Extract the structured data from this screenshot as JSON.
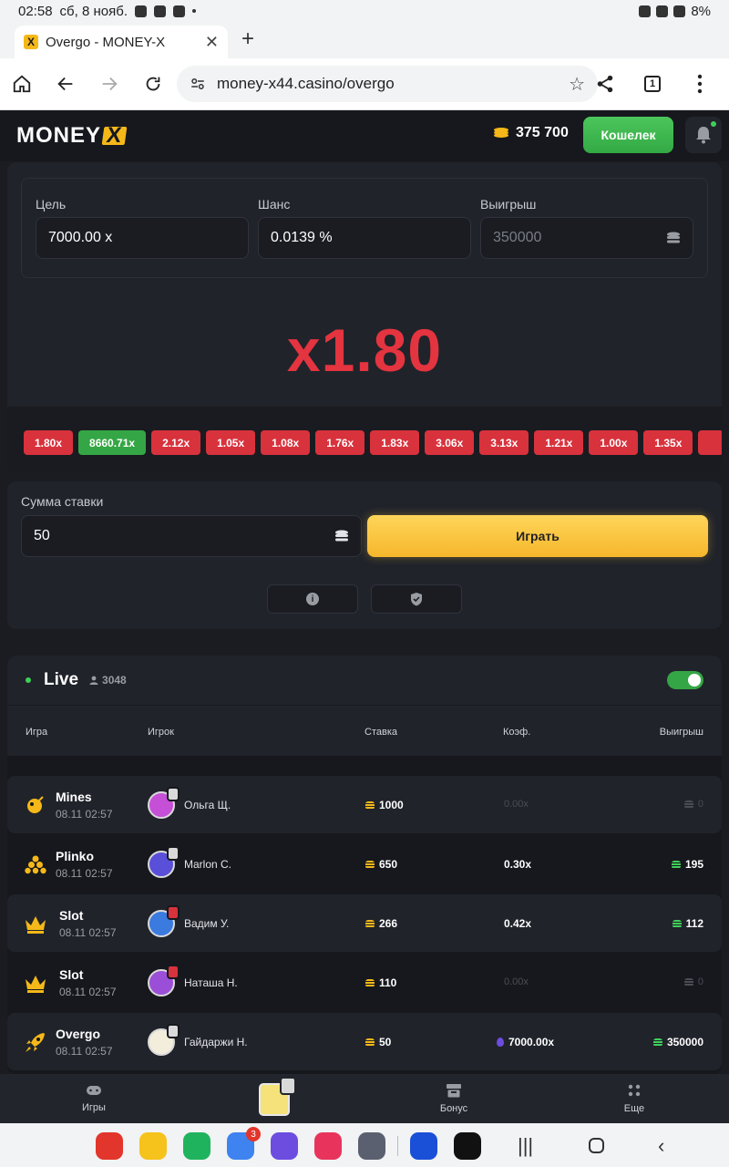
{
  "statusbar": {
    "time": "02:58",
    "date": "сб, 8 нояб.",
    "battery": "8%"
  },
  "browser": {
    "tab_title": "Overgo - MONEY-X",
    "favicon_letter": "X",
    "url": "money-x44.casino/overgo",
    "tab_count": "1"
  },
  "header": {
    "logo_text": "MONEY",
    "logo_x": "X",
    "balance": "375 700",
    "wallet_label": "Кошелек"
  },
  "game": {
    "target_label": "Цель",
    "target_value": "7000.00 x",
    "chance_label": "Шанс",
    "chance_value": "0.0139 %",
    "win_label": "Выигрыш",
    "win_value": "350000",
    "multiplier": "x1.80",
    "history": [
      {
        "label": "1.80x",
        "color": "#d8323d"
      },
      {
        "label": "8660.71x",
        "color": "#35a645"
      },
      {
        "label": "2.12x",
        "color": "#d8323d"
      },
      {
        "label": "1.05x",
        "color": "#d8323d"
      },
      {
        "label": "1.08x",
        "color": "#d8323d"
      },
      {
        "label": "1.76x",
        "color": "#d8323d"
      },
      {
        "label": "1.83x",
        "color": "#d8323d"
      },
      {
        "label": "3.06x",
        "color": "#d8323d"
      },
      {
        "label": "3.13x",
        "color": "#d8323d"
      },
      {
        "label": "1.21x",
        "color": "#d8323d"
      },
      {
        "label": "1.00x",
        "color": "#d8323d"
      },
      {
        "label": "1.35x",
        "color": "#d8323d"
      },
      {
        "label": "",
        "color": "#d8323d"
      }
    ]
  },
  "bet": {
    "label": "Сумма ставки",
    "value": "50",
    "play_label": "Играть",
    "info_icon": "i"
  },
  "live": {
    "title": "Live",
    "online_count": "3048",
    "toggle_on": true,
    "columns": {
      "game": "Игра",
      "player": "Игрок",
      "stake": "Ставка",
      "coef": "Коэф.",
      "win": "Выигрыш"
    },
    "rows": [
      {
        "game": "Mines",
        "time": "08.11 02:57",
        "icon": "mines-icon",
        "player": "Ольга Щ.",
        "avatar_color": "#c64fd8",
        "badge": "silver",
        "stake": "1000",
        "coef": "0.00x",
        "win": "0",
        "is_win": false
      },
      {
        "game": "Plinko",
        "time": "08.11 02:57",
        "icon": "plinko-icon",
        "player": "Marlon C.",
        "avatar_color": "#5a4fd8",
        "badge": "silver",
        "stake": "650",
        "coef": "0.30x",
        "win": "195",
        "is_win": true
      },
      {
        "game": "Slot",
        "time": "08.11 02:57",
        "icon": "crown-icon",
        "player": "Вадим У.",
        "avatar_color": "#3b7be0",
        "badge": "red",
        "stake": "266",
        "coef": "0.42x",
        "win": "112",
        "is_win": true
      },
      {
        "game": "Slot",
        "time": "08.11 02:57",
        "icon": "crown-icon",
        "player": "Наташа Н.",
        "avatar_color": "#9b4fd8",
        "badge": "red",
        "stake": "110",
        "coef": "0.00x",
        "win": "0",
        "is_win": false
      },
      {
        "game": "Overgo",
        "time": "08.11 02:57",
        "icon": "rocket-icon",
        "player": "Гайдаржи Н.",
        "avatar_color": "#f3eddc",
        "badge": "silver",
        "stake": "50",
        "coef": "7000.00x",
        "win": "350000",
        "is_win": true
      }
    ]
  },
  "bottom_nav": {
    "games": "Игры",
    "bonus": "Бонус",
    "more": "Еще"
  },
  "sysnav": {
    "notification_count": "3"
  }
}
